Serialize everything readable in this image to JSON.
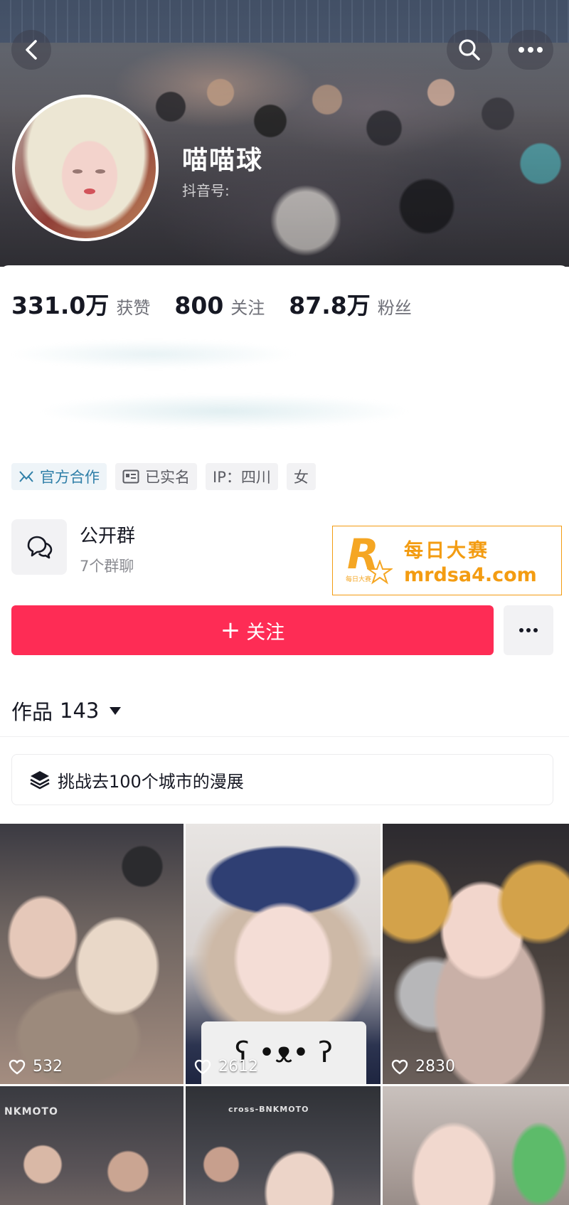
{
  "header": {
    "username": "喵喵球",
    "douyin_id_label": "抖音号:"
  },
  "stats": [
    {
      "value": "331.0万",
      "label": "获赞"
    },
    {
      "value": "800",
      "label": "关注"
    },
    {
      "value": "87.8万",
      "label": "粉丝"
    }
  ],
  "tags": [
    {
      "label": "官方合作",
      "icon": "official-cooperation-icon"
    },
    {
      "label": "已实名",
      "icon": "id-card-icon"
    },
    {
      "label": "IP：四川"
    },
    {
      "label": "女"
    }
  ],
  "group": {
    "title": "公开群",
    "subtitle": "7个群聊"
  },
  "watermark": {
    "line1": "每日大赛",
    "line2": "mrdsa4.com",
    "logo_letter": "R",
    "logo_small": "每日大赛"
  },
  "actions": {
    "follow_label": "关注",
    "follow_plus": "+"
  },
  "works": {
    "label": "作品",
    "count": "143",
    "collection_label": "挑战去100个城市的漫展"
  },
  "videos": [
    {
      "likes": "532",
      "label": "NKMOTO"
    },
    {
      "likes": "2612",
      "overlay": "ʕ •ᴥ• ʔ"
    },
    {
      "likes": "2830"
    },
    {
      "label": "NKMOTO"
    },
    {
      "label": "cross-BNKMOTO"
    },
    {}
  ],
  "colors": {
    "accent": "#fe2c55",
    "official_tag": "#2f7fa8",
    "watermark": "#f39c12"
  }
}
